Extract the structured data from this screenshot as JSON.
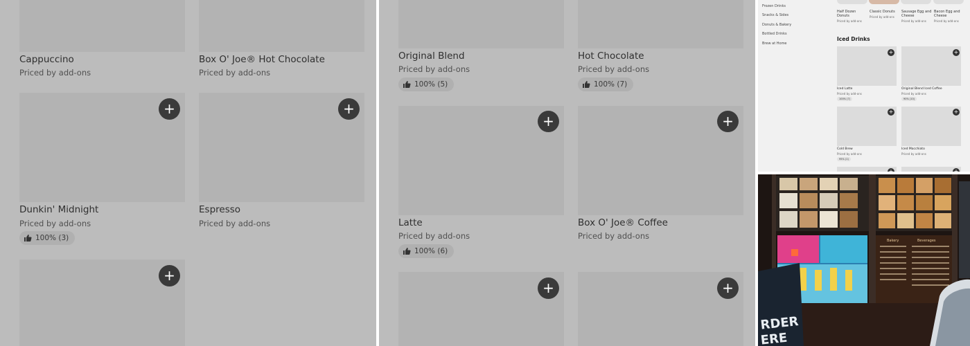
{
  "panel_a": {
    "items": [
      {
        "name": "Cappuccino",
        "price": "Priced by add-ons",
        "rating": null
      },
      {
        "name": "Box O' Joe® Hot Chocolate",
        "price": "Priced by add-ons",
        "rating": null
      },
      {
        "name": "Dunkin' Midnight",
        "price": "Priced by add-ons",
        "rating": "100% (3)"
      },
      {
        "name": "Espresso",
        "price": "Priced by add-ons",
        "rating": null
      }
    ]
  },
  "panel_b": {
    "items": [
      {
        "name": "Original Blend",
        "price": "Priced by add-ons",
        "rating": "100% (5)"
      },
      {
        "name": "Hot Chocolate",
        "price": "Priced by add-ons",
        "rating": "100% (7)"
      },
      {
        "name": "Latte",
        "price": "Priced by add-ons",
        "rating": "100% (6)"
      },
      {
        "name": "Box O' Joe® Coffee",
        "price": "Priced by add-ons",
        "rating": null
      }
    ]
  },
  "mini_menu": {
    "categories": [
      "Frozen Drinks",
      "Snacks & Sides",
      "Donuts & Bakery",
      "Bottled Drinks",
      "Brew at Home"
    ],
    "top_items": [
      {
        "name": "Half Dozen Donuts",
        "price": "Priced by add-ons"
      },
      {
        "name": "Classic Donuts",
        "price": "Priced by add-ons"
      },
      {
        "name": "Sausage Egg and Cheese",
        "price": "Priced by add-ons"
      },
      {
        "name": "Bacon Egg and Cheese",
        "price": "Priced by add-ons"
      }
    ],
    "section_heading": "Iced Drinks",
    "section_items": [
      {
        "name": "Iced Latte",
        "price": "Priced by add-ons",
        "rating": "100% (7)"
      },
      {
        "name": "Original Blend Iced Coffee",
        "price": "Priced by add-ons",
        "rating": "90% (10)"
      },
      {
        "name": "Cold Brew",
        "price": "Priced by add-ons",
        "rating": "95% (1)"
      },
      {
        "name": "Iced Macchiato",
        "price": "Priced by add-ons",
        "rating": null
      }
    ]
  },
  "photo": {
    "menu_board_headings": [
      "Bakery",
      "Beverages"
    ],
    "sign_text": [
      "RDER",
      "ERE"
    ]
  },
  "icons": {
    "add": "+",
    "rating": "thumbs-up-icon"
  },
  "colors": {
    "panel_bg": "#bcbcbc",
    "placeholder": "#b3b3b3",
    "button": "#3a3a3a"
  }
}
